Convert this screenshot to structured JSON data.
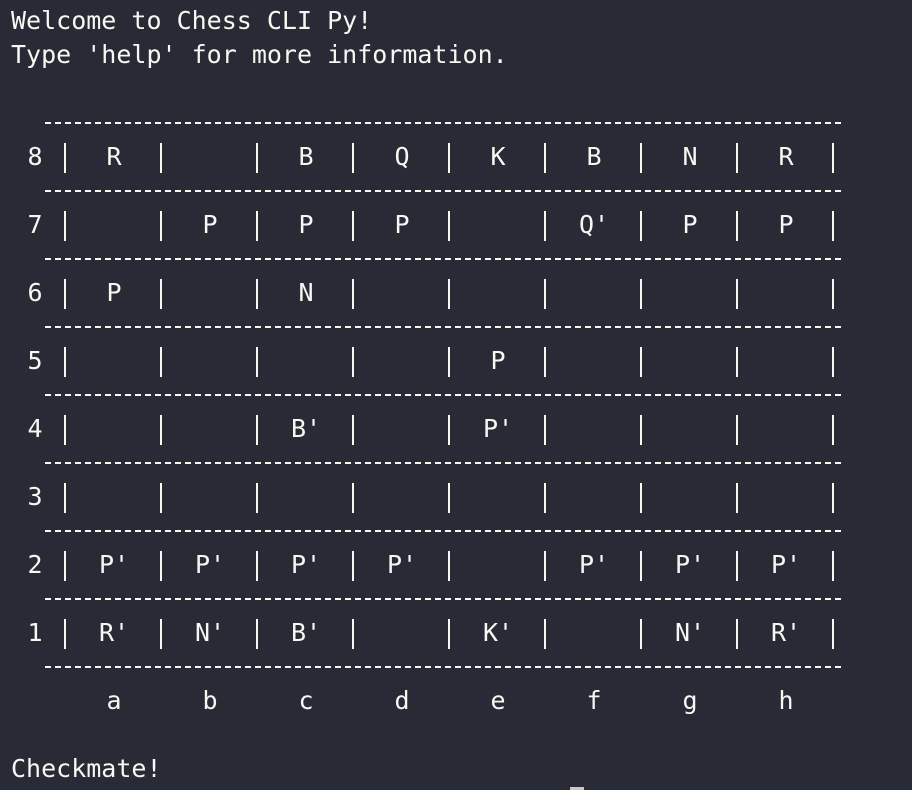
{
  "terminal": {
    "welcome": "Welcome to Chess CLI Py!",
    "help": "Type 'help' for more information.",
    "status": "Checkmate!"
  },
  "board": {
    "ranks": [
      "8",
      "7",
      "6",
      "5",
      "4",
      "3",
      "2",
      "1"
    ],
    "files": [
      "a",
      "b",
      "c",
      "d",
      "e",
      "f",
      "g",
      "h"
    ],
    "rows": [
      [
        "R",
        "",
        "B",
        "Q",
        "K",
        "B",
        "N",
        "R"
      ],
      [
        "",
        "P",
        "P",
        "P",
        "",
        "Q'",
        "P",
        "P"
      ],
      [
        "P",
        "",
        "N",
        "",
        "",
        "",
        "",
        ""
      ],
      [
        "",
        "",
        "",
        "",
        "P",
        "",
        "",
        ""
      ],
      [
        "",
        "",
        "B'",
        "",
        "P'",
        "",
        "",
        ""
      ],
      [
        "",
        "",
        "",
        "",
        "",
        "",
        "",
        ""
      ],
      [
        "P'",
        "P'",
        "P'",
        "P'",
        "",
        "P'",
        "P'",
        "P'"
      ],
      [
        "R'",
        "N'",
        "B'",
        "",
        "K'",
        "",
        "N'",
        "R'"
      ]
    ]
  }
}
